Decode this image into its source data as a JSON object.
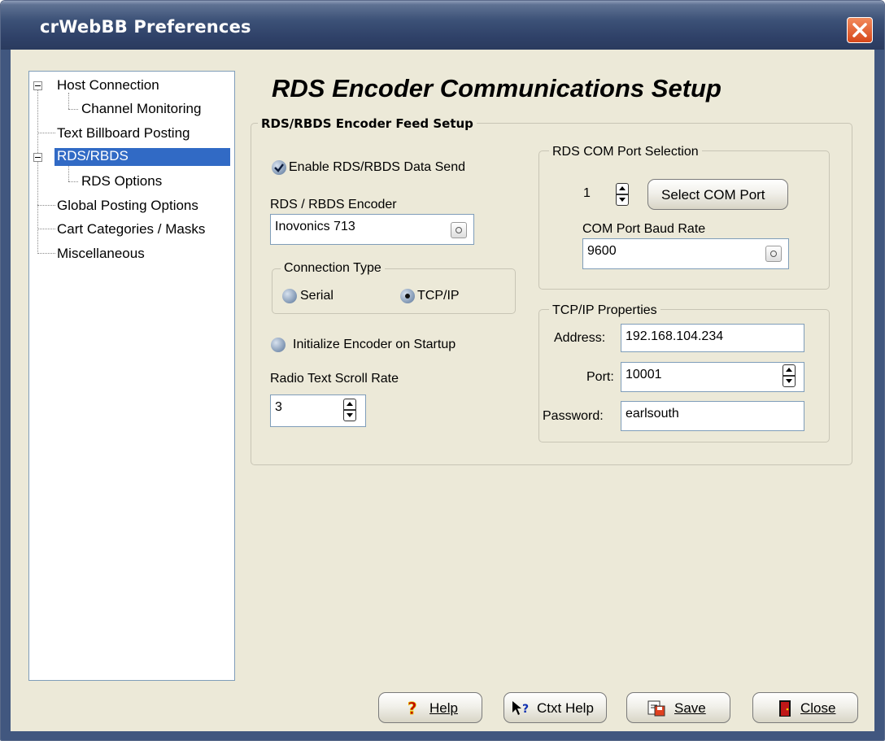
{
  "window": {
    "title": "crWebBB Preferences"
  },
  "tree": {
    "items": [
      {
        "label": "Host Connection"
      },
      {
        "label": "Channel Monitoring"
      },
      {
        "label": "Text Billboard Posting"
      },
      {
        "label": "RDS/RBDS"
      },
      {
        "label": "RDS Options"
      },
      {
        "label": "Global Posting Options"
      },
      {
        "label": "Cart Categories / Masks"
      },
      {
        "label": "Miscellaneous"
      }
    ]
  },
  "page": {
    "heading": "RDS Encoder Communications Setup",
    "feed_group": "RDS/RBDS Encoder Feed Setup",
    "enable_label": "Enable RDS/RBDS Data Send",
    "enable_checked": true,
    "encoder_label": "RDS / RBDS Encoder",
    "encoder_value": "Inovonics 713",
    "conn_group": "Connection Type",
    "conn_serial": "Serial",
    "conn_tcpip": "TCP/IP",
    "conn_selected": "TCP/IP",
    "init_label": "Initialize Encoder on Startup",
    "init_checked": false,
    "scroll_label": "Radio Text Scroll Rate",
    "scroll_value": "3",
    "com_group": "RDS COM Port Selection",
    "com_port": "1",
    "select_com_label": "Select COM Port",
    "baud_label": "COM Port Baud Rate",
    "baud_value": "9600",
    "tcp_group": "TCP/IP Properties",
    "address_label": "Address:",
    "address_value": "192.168.104.234",
    "port_label": "Port:",
    "port_value": "10001",
    "password_label": "Password:",
    "password_value": "earlsouth"
  },
  "buttons": {
    "help": "Help",
    "ctxt": "Ctxt Help",
    "save": "Save",
    "close": "Close"
  }
}
